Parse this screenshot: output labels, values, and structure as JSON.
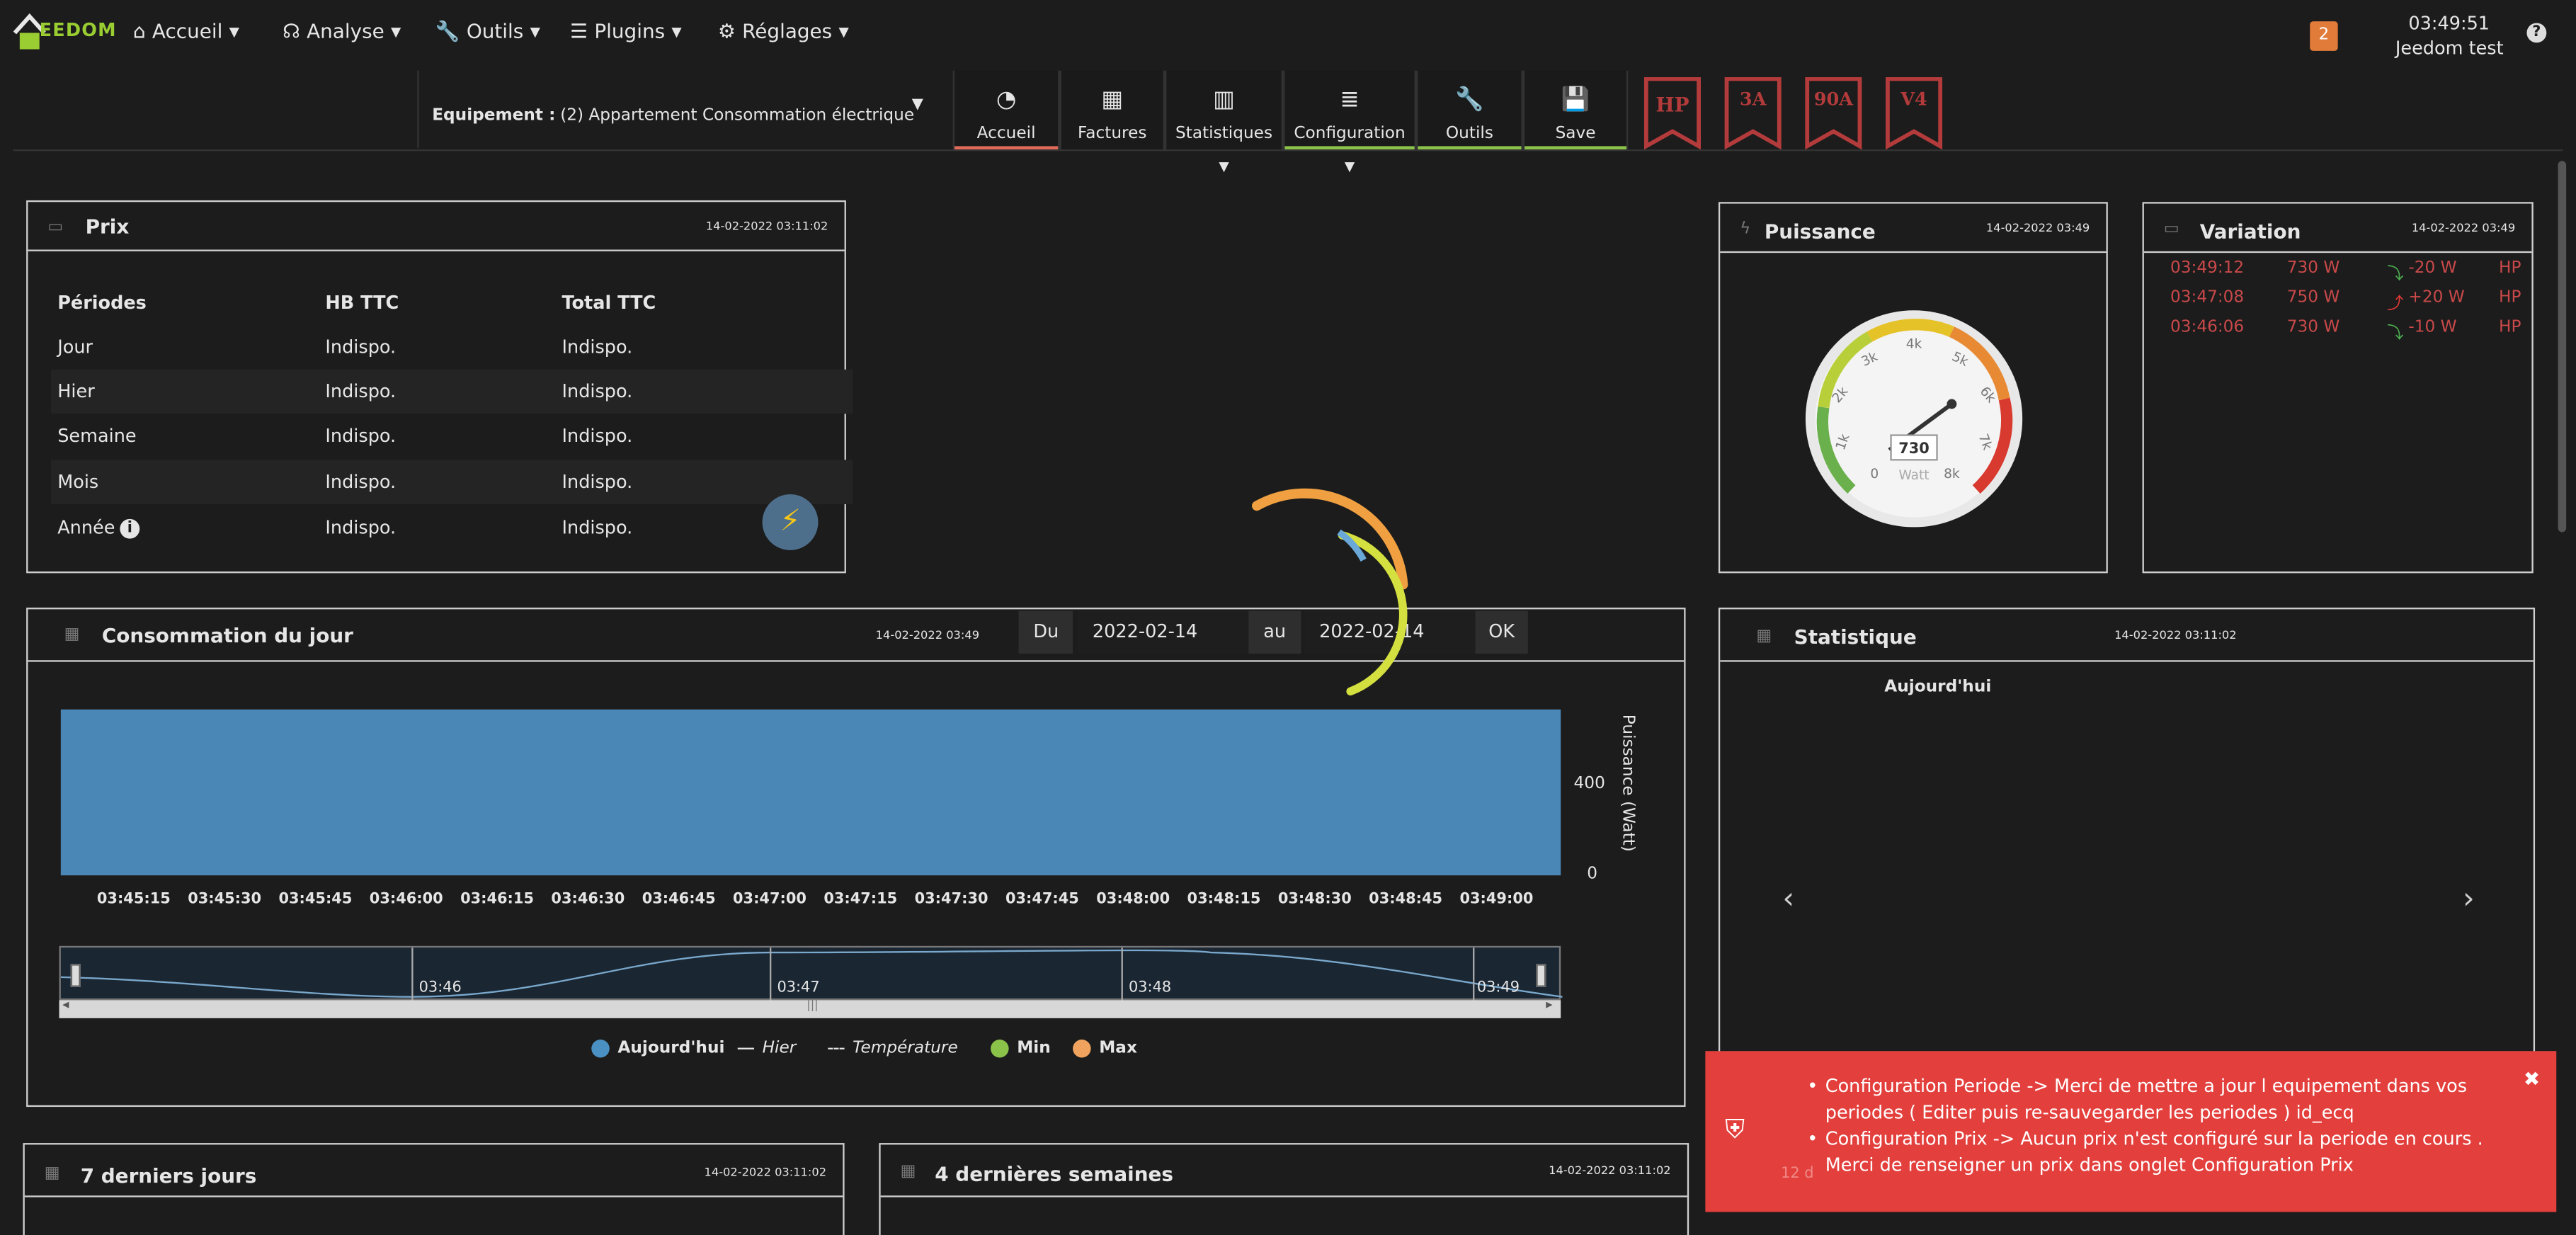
{
  "brand": {
    "logo_text": "EEDOM"
  },
  "nav": {
    "menus": [
      {
        "label": "Accueil",
        "icon": "home-icon"
      },
      {
        "label": "Analyse",
        "icon": "stethoscope-icon"
      },
      {
        "label": "Outils",
        "icon": "wrench-icon"
      },
      {
        "label": "Plugins",
        "icon": "list-icon"
      },
      {
        "label": "Réglages",
        "icon": "cogs-icon"
      }
    ],
    "notification_count": "2",
    "time": "03:49:51",
    "user": "Jeedom test",
    "help": "?"
  },
  "toolbar": {
    "equipment_label": "Equipement :",
    "equipment_value": "(2) Appartement Consommation électrique",
    "tabs": [
      {
        "label": "Accueil",
        "icon": "dashboard-icon",
        "underline": "#e06a5a"
      },
      {
        "label": "Factures",
        "icon": "table-icon",
        "underline": ""
      },
      {
        "label": "Statistiques",
        "icon": "bar-chart-icon",
        "underline": ""
      },
      {
        "label": "Configuration",
        "icon": "database-icon",
        "underline": "#8bc34a"
      },
      {
        "label": "Outils",
        "icon": "wrench-icon",
        "underline": "#8bc34a"
      },
      {
        "label": "Save",
        "icon": "save-icon",
        "underline": "#8bc34a"
      }
    ],
    "ribbons": [
      "HP",
      "3A",
      "90A",
      "V4"
    ]
  },
  "prix": {
    "title": "Prix",
    "date": "14-02-2022 03:11:02",
    "headers": [
      "Périodes",
      "HB TTC",
      "Total TTC"
    ],
    "rows": [
      {
        "period": "Jour",
        "hb": "Indispo.",
        "total": "Indispo."
      },
      {
        "period": "Hier",
        "hb": "Indispo.",
        "total": "Indispo."
      },
      {
        "period": "Semaine",
        "hb": "Indispo.",
        "total": "Indispo."
      },
      {
        "period": "Mois",
        "hb": "Indispo.",
        "total": "Indispo."
      },
      {
        "period": "Année",
        "hb": "Indispo.",
        "total": "Indispo."
      }
    ]
  },
  "puissance": {
    "title": "Puissance",
    "date": "14-02-2022 03:49",
    "value": "730",
    "unit": "Watt",
    "ticks": [
      "0",
      "1k",
      "2k",
      "3k",
      "4k",
      "5k",
      "6k",
      "7k",
      "8k"
    ]
  },
  "variation": {
    "title": "Variation",
    "date": "14-02-2022 03:49",
    "rows": [
      {
        "time": "03:49:12",
        "power": "730 W",
        "delta": "-20 W",
        "tag": "HP"
      },
      {
        "time": "03:47:08",
        "power": "750 W",
        "delta": "+20 W",
        "tag": "HP"
      },
      {
        "time": "03:46:06",
        "power": "730 W",
        "delta": "-10 W",
        "tag": "HP"
      }
    ]
  },
  "consommation": {
    "title": "Consommation du jour",
    "date": "14-02-2022 03:49",
    "from_label": "Du",
    "from_value": "2022-02-14",
    "to_label": "au",
    "to_value": "2022-02-14",
    "ok_label": "OK",
    "navigator_labels": [
      "03:46",
      "03:47",
      "03:48",
      "03:49"
    ],
    "legend": [
      {
        "name": "Aujourd'hui",
        "color": "#4a90c2"
      },
      {
        "name": "Hier",
        "color": "#e6e6e6"
      },
      {
        "name": "Température",
        "color": "#e6e6e6"
      },
      {
        "name": "Min",
        "color": "#8bc34a"
      },
      {
        "name": "Max",
        "color": "#f0a35e"
      }
    ]
  },
  "chart_data": {
    "type": "area",
    "x": [
      "03:45:15",
      "03:45:30",
      "03:45:45",
      "03:46:00",
      "03:46:15",
      "03:46:30",
      "03:46:45",
      "03:47:00",
      "03:47:15",
      "03:47:30",
      "03:47:45",
      "03:48:00",
      "03:48:15",
      "03:48:30",
      "03:48:45",
      "03:49:00"
    ],
    "series": [
      {
        "name": "Aujourd'hui",
        "values": [
          730,
          730,
          730,
          730,
          730,
          735,
          750,
          750,
          750,
          750,
          750,
          750,
          750,
          745,
          740,
          730
        ]
      }
    ],
    "yticks": [
      "0",
      "400"
    ],
    "ylabel": "Puissance (Watt)",
    "ylim": [
      0,
      800
    ]
  },
  "statistique": {
    "title": "Statistique",
    "date": "14-02-2022 03:11:02",
    "subtitle": "Aujourd'hui"
  },
  "sept_jours": {
    "title": "7 derniers jours",
    "date": "14-02-2022 03:11:02"
  },
  "quatre_semaines": {
    "title": "4 dernières semaines",
    "date": "14-02-2022 03:11:02"
  },
  "alert": {
    "messages": [
      "Configuration Periode -> Merci de mettre a jour l equipement dans vos periodes ( Editer puis re-sauvegarder les periodes ) id_ecq",
      "Configuration Prix -> Aucun prix n'est configuré sur la periode en cours . Merci de renseigner un prix dans onglet Configuration Prix"
    ],
    "hidden_text": "12 d"
  }
}
